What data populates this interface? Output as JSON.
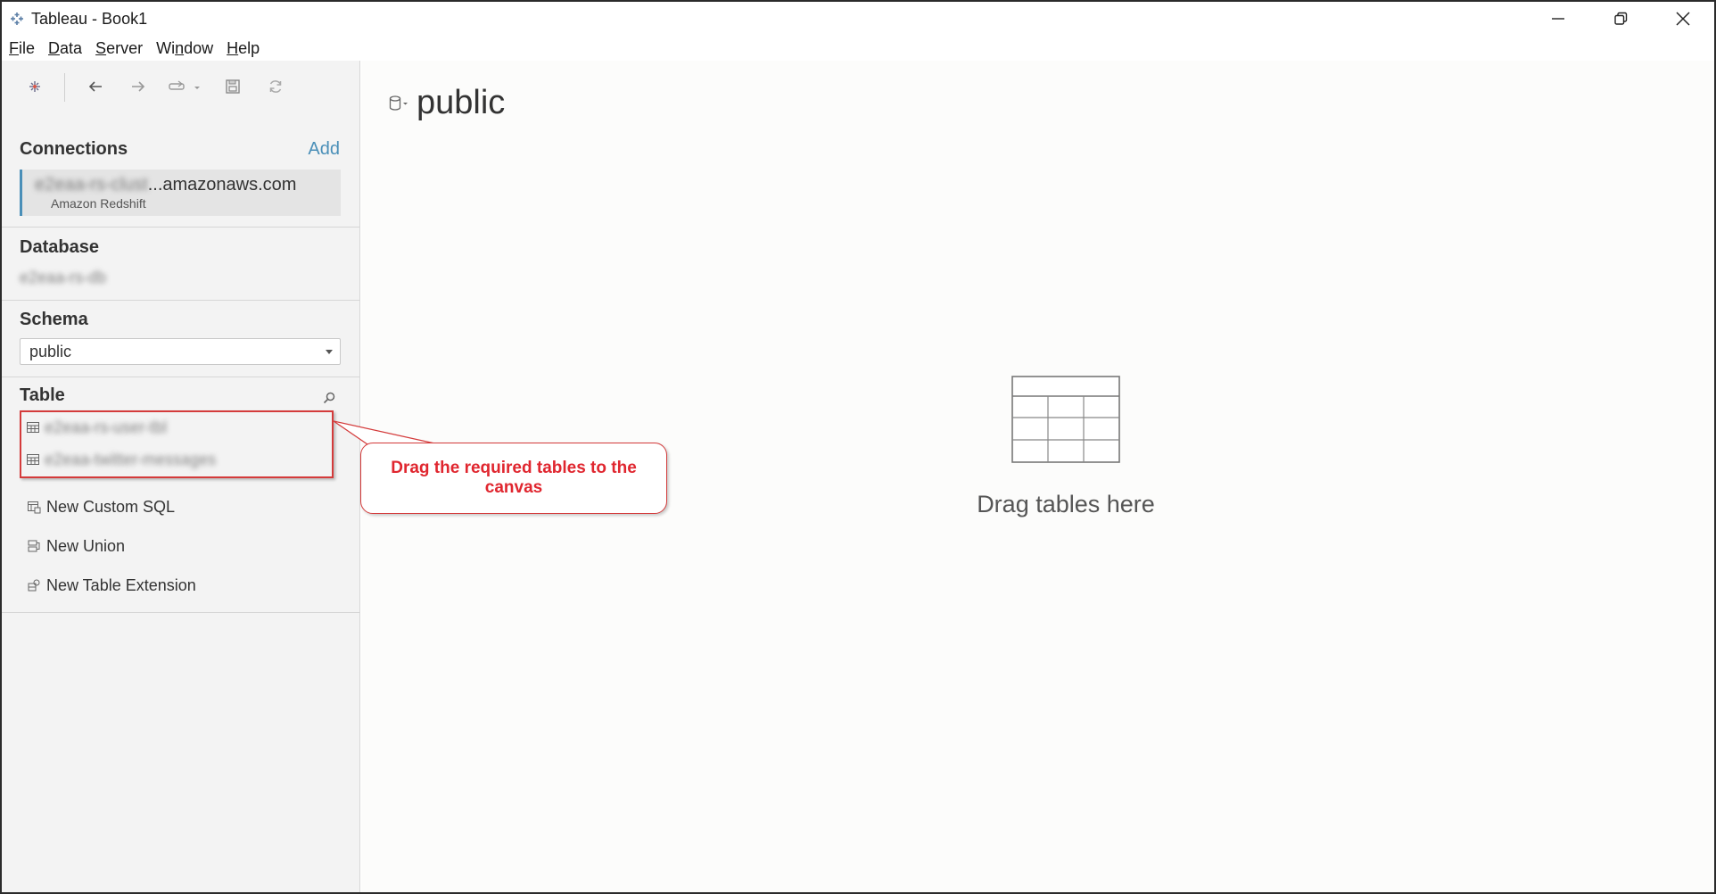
{
  "window": {
    "title": "Tableau - Book1",
    "controls": [
      "minimize-icon",
      "restore-icon",
      "close-icon"
    ]
  },
  "menu": [
    {
      "label": "File",
      "mnemonic": "F"
    },
    {
      "label": "Data",
      "mnemonic": "D"
    },
    {
      "label": "Server",
      "mnemonic": "S"
    },
    {
      "label": "Window",
      "mnemonic": "n"
    },
    {
      "label": "Help",
      "mnemonic": "H"
    }
  ],
  "toolbar": {
    "icons": [
      "tableau-logo-icon",
      "back-icon",
      "forward-icon",
      "data-source-icon",
      "save-icon",
      "refresh-icon"
    ]
  },
  "connections": {
    "title": "Connections",
    "add_label": "Add",
    "host_blurred": "e2eaa-rs-clust",
    "host_suffix": "...amazonaws.com",
    "type": "Amazon Redshift"
  },
  "database": {
    "title": "Database",
    "value_blurred": "e2eaa-rs-db"
  },
  "schema": {
    "title": "Schema",
    "value": "public"
  },
  "tables": {
    "title": "Table",
    "items_blurred": [
      "e2eaa-rs-user-tbl",
      "e2eaa-twitter-messages"
    ]
  },
  "actions": [
    {
      "label": "New Custom SQL",
      "icon": "custom-sql-icon"
    },
    {
      "label": "New Union",
      "icon": "union-icon"
    },
    {
      "label": "New Table Extension",
      "icon": "table-extension-icon"
    }
  ],
  "callout": {
    "text": "Drag the required tables to the canvas"
  },
  "canvas": {
    "title": "public",
    "drop_text": "Drag tables here"
  },
  "colors": {
    "accent": "#4a8fb8",
    "annotation_red": "#e0262f",
    "pane_bg": "#f3f3f3"
  }
}
